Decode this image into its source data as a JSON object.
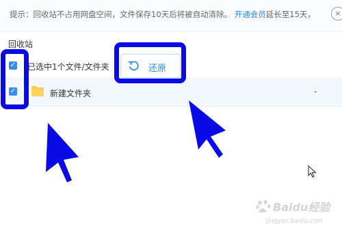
{
  "tip": {
    "text": "提示：回收站不占用网盘空间，文件保存10天后将被自动清除。",
    "link": "开通会员",
    "suffix": "延长至15天，",
    "close_glyph": "×"
  },
  "section_title": "回收站",
  "header": {
    "selected_text": "已选中1个文件/文件夹",
    "restore_label": "还原"
  },
  "files": [
    {
      "name": "新建文件夹",
      "size": "-",
      "checked": true
    }
  ],
  "checkbox_glyph": "✓",
  "watermark": {
    "brand": "Baidu经验",
    "url": "jingyan.baidu.com"
  },
  "colors": {
    "accent": "#2d8cf0",
    "highlight": "#0a0ae6",
    "row_selected": "#f2f8fe",
    "folder": "#ffc94c"
  }
}
